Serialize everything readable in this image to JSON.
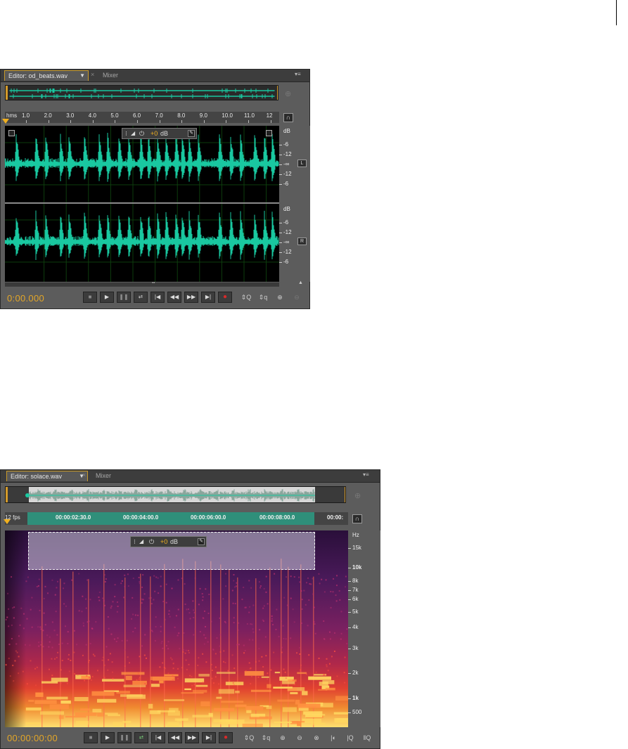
{
  "page": {
    "corner_mark": ""
  },
  "editor1": {
    "tab_label": "Editor: od_beats.wav",
    "mixer_label": "Mixer",
    "ruler_unit": "hms",
    "ruler_ticks": [
      "1.0",
      "2.0",
      "3.0",
      "4.0",
      "5.0",
      "6.0",
      "7.0",
      "8.0",
      "9.0",
      "10.0",
      "11.0",
      "12"
    ],
    "hud": {
      "gain_value": "+0",
      "unit": "dB"
    },
    "channels": [
      {
        "id": "L",
        "scale": [
          "dB",
          "-6",
          "-12",
          "-∞",
          "-12",
          "-6"
        ]
      },
      {
        "id": "R",
        "scale": [
          "dB",
          "-6",
          "-12",
          "-∞",
          "-12",
          "-6"
        ]
      }
    ],
    "time": "0:00.000",
    "waveform_color": "#19c8a0"
  },
  "editor2": {
    "tab_label": "Editor: solace.wav",
    "mixer_label": "Mixer",
    "ruler_unit": "12 fps",
    "ruler_ticks": [
      "00:00:02:30.0",
      "00:00:04:00.0",
      "00:00:06:00.0",
      "00:00:08:00.0",
      "00:00:"
    ],
    "hud": {
      "gain_value": "+0",
      "unit": "dB"
    },
    "hz_scale": [
      "Hz",
      "15k",
      "10k",
      "8k",
      "7k",
      "6k",
      "5k",
      "4k",
      "3k",
      "2k",
      "1k",
      "500"
    ],
    "time": "00:00:00:00",
    "selection_color": "#2f8f7a"
  },
  "transport": {
    "buttons": [
      {
        "name": "stop-button",
        "icon": "■"
      },
      {
        "name": "play-button",
        "icon": "▶"
      },
      {
        "name": "pause-button",
        "icon": "❚❚"
      },
      {
        "name": "loop-button",
        "icon": "⮂"
      },
      {
        "name": "go-to-start-button",
        "icon": "|◀"
      },
      {
        "name": "rewind-button",
        "icon": "◀◀"
      },
      {
        "name": "fast-forward-button",
        "icon": "▶▶"
      },
      {
        "name": "go-to-end-button",
        "icon": "▶|"
      },
      {
        "name": "record-button",
        "icon": "●"
      }
    ],
    "zoom_icons_1": [
      "⇕Q",
      "⇕q",
      "⊕",
      "⊖"
    ],
    "zoom_icons_2": [
      "⇕Q",
      "⇕q",
      "⊕",
      "⊖",
      "⊗",
      "|◐",
      "|Q",
      "‖Q"
    ]
  },
  "colors": {
    "accent": "#e3a628",
    "panel": "#5c5c5c",
    "wave": "#19c8a0"
  }
}
